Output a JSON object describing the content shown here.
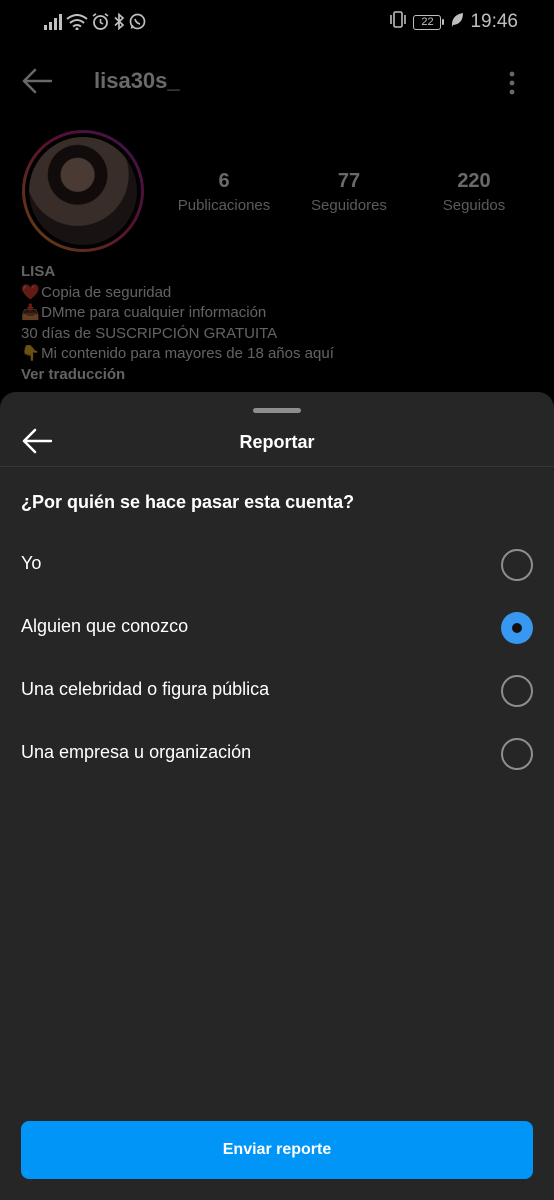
{
  "status_bar": {
    "time": "19:46",
    "battery_level": "22",
    "left_icons": [
      "signal-icon",
      "wifi-icon",
      "alarm-icon",
      "bluetooth-icon",
      "whatsapp-icon"
    ],
    "right_icons": [
      "vibrate-icon",
      "battery-icon",
      "leaf-icon"
    ]
  },
  "profile": {
    "username": "lisa30s_",
    "stats": [
      {
        "value": "6",
        "label": "Publicaciones"
      },
      {
        "value": "77",
        "label": "Seguidores"
      },
      {
        "value": "220",
        "label": "Seguidos"
      }
    ],
    "bio": {
      "name": "LISA",
      "lines": [
        {
          "emoji": "❤️",
          "text": "Copia de seguridad"
        },
        {
          "emoji": "📥",
          "text": "DMme para cualquier información"
        },
        {
          "emoji": "",
          "text": "30 días de SUSCRIPCIÓN GRATUITA"
        },
        {
          "emoji": "👇",
          "text": "Mi contenido para mayores de 18 años aquí"
        }
      ],
      "translate_link": "Ver traducción"
    }
  },
  "sheet": {
    "title": "Reportar",
    "question": "¿Por quién se hace pasar esta cuenta?",
    "options": [
      {
        "label": "Yo",
        "selected": false
      },
      {
        "label": "Alguien que conozco",
        "selected": true
      },
      {
        "label": "Una celebridad o figura pública",
        "selected": false
      },
      {
        "label": "Una empresa u organización",
        "selected": false
      }
    ],
    "submit_label": "Enviar reporte"
  },
  "colors": {
    "accent": "#0095f6",
    "radio_selected": "#3897f0",
    "sheet_bg": "#262626",
    "background": "#000000"
  }
}
